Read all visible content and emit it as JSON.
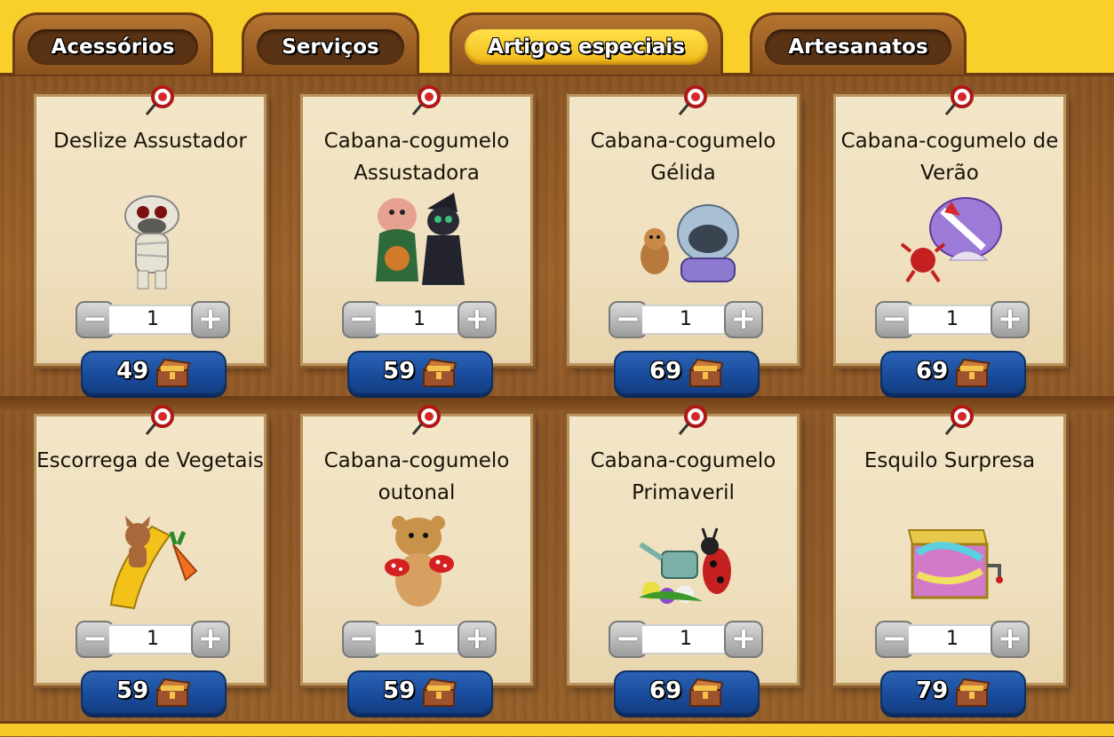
{
  "tabs": [
    {
      "label": "Acessórios",
      "active": false
    },
    {
      "label": "Serviços",
      "active": false
    },
    {
      "label": "Artigos especiais",
      "active": true
    },
    {
      "label": "Artesanatos",
      "active": false
    }
  ],
  "items": [
    {
      "title": "Deslize Assustador",
      "quantity": "1",
      "price": "49",
      "icon": "mummy-cow-icon"
    },
    {
      "title": "Cabana-cogumelo Assustadora",
      "quantity": "1",
      "price": "59",
      "icon": "pig-and-cat-costume-icon"
    },
    {
      "title": "Cabana-cogumelo Gélida",
      "quantity": "1",
      "price": "69",
      "icon": "hamster-snow-globe-icon"
    },
    {
      "title": "Cabana-cogumelo de Verão",
      "quantity": "1",
      "price": "69",
      "icon": "crab-shell-mushroom-icon"
    },
    {
      "title": "Escorrega de Vegetais",
      "quantity": "1",
      "price": "59",
      "icon": "cat-carrot-slide-icon"
    },
    {
      "title": "Cabana-cogumelo outonal",
      "quantity": "1",
      "price": "59",
      "icon": "hamster-mushrooms-icon"
    },
    {
      "title": "Cabana-cogumelo Primaveril",
      "quantity": "1",
      "price": "69",
      "icon": "ladybug-watering-can-icon"
    },
    {
      "title": "Esquilo Surpresa",
      "quantity": "1",
      "price": "79",
      "icon": "surprise-box-icon"
    }
  ],
  "stepper": {
    "minus_symbol": "−",
    "plus_symbol": "+"
  },
  "colors": {
    "board": "#8a5422",
    "card": "#f0e3c3",
    "price_button": "#1a4c9c",
    "active_tab": "#f7c928"
  }
}
